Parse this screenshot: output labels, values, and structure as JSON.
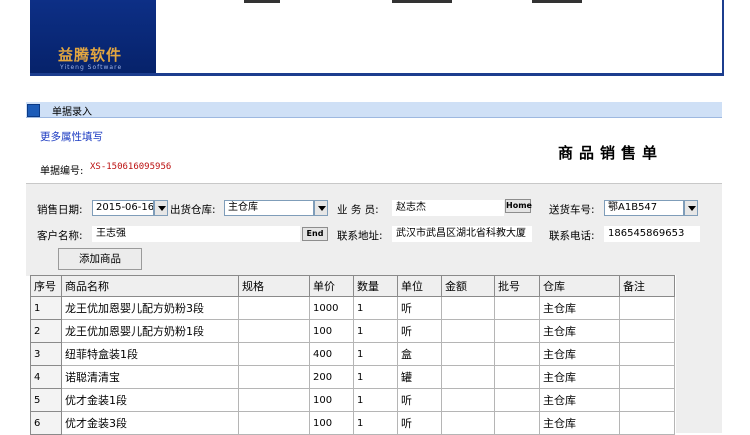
{
  "banner": {
    "logo_text": "益腾软件",
    "logo_sub": "Yiteng Software"
  },
  "tab": {
    "label": "单据录入"
  },
  "form": {
    "more_link": "更多属性填写",
    "doc_no_label": "单据编号:",
    "doc_no_value": "XS-150616095956",
    "title": "商品销售单",
    "sale_date_label": "销售日期:",
    "sale_date_value": "2015-06-16",
    "warehouse_label": "出货仓库:",
    "warehouse_value": "主仓库",
    "salesman_label": "业 务 员:",
    "salesman_value": "赵志杰",
    "home_button": "Home",
    "plate_label": "送货车号:",
    "plate_value": "鄂A1B547",
    "customer_label": "客户名称:",
    "customer_value": "王志强",
    "end_button": "End",
    "address_label": "联系地址:",
    "address_value": "武汉市武昌区湖北省科教大厦",
    "phone_label": "联系电话:",
    "phone_value": "186545869653",
    "add_button": "添加商品"
  },
  "grid": {
    "columns": [
      "序号",
      "商品名称",
      "规格",
      "单价",
      "数量",
      "单位",
      "金额",
      "批号",
      "仓库",
      "备注"
    ],
    "rows": [
      [
        "1",
        "龙王优加恩婴儿配方奶粉3段",
        "",
        "1000",
        "1",
        "听",
        "",
        "",
        "主仓库",
        ""
      ],
      [
        "2",
        "龙王优加恩婴儿配方奶粉1段",
        "",
        "100",
        "1",
        "听",
        "",
        "",
        "主仓库",
        ""
      ],
      [
        "3",
        "纽菲特盒装1段",
        "",
        "400",
        "1",
        "盒",
        "",
        "",
        "主仓库",
        ""
      ],
      [
        "4",
        "诺聪清清宝",
        "",
        "200",
        "1",
        "罐",
        "",
        "",
        "主仓库",
        ""
      ],
      [
        "5",
        "优才金装1段",
        "",
        "100",
        "1",
        "听",
        "",
        "",
        "主仓库",
        ""
      ],
      [
        "6",
        "优才金装3段",
        "",
        "100",
        "1",
        "听",
        "",
        "",
        "主仓库",
        ""
      ]
    ]
  },
  "colors": {
    "banner": "#0a2a7a",
    "logo": "#e3a640",
    "tabbar": "#cfe0f6",
    "link": "#1d3cc2",
    "doc_no": "#bb1111"
  }
}
